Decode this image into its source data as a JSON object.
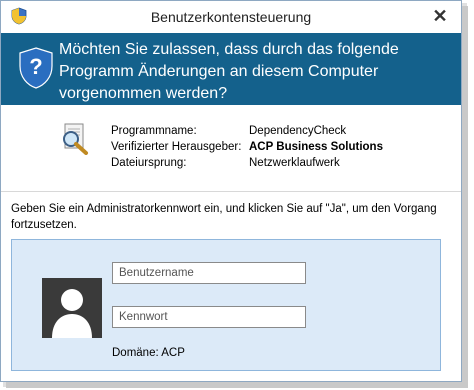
{
  "window": {
    "title": "Benutzerkontensteuerung",
    "close_glyph": "✕"
  },
  "banner": {
    "question": "Möchten Sie zulassen, dass durch das folgende Programm Änderungen an diesem Computer vorgenommen werden?",
    "color": "#14618c"
  },
  "program": {
    "name_label": "Programmname:",
    "name_value": "DependencyCheck",
    "publisher_label": "Verifizierter Herausgeber:",
    "publisher_value": "ACP Business Solutions",
    "origin_label": "Dateiursprung:",
    "origin_value": "Netzwerklaufwerk",
    "icon": "magnifier-document-icon"
  },
  "credentials": {
    "instruction": "Geben Sie ein Administratorkennwort ein, und klicken Sie auf \"Ja\", um den Vorgang fortzusetzen.",
    "username_placeholder": "Benutzername",
    "password_placeholder": "Kennwort",
    "domain": "Domäne: ACP",
    "avatar_icon": "user-silhouette-icon",
    "panel_color": "#dceaf8"
  }
}
